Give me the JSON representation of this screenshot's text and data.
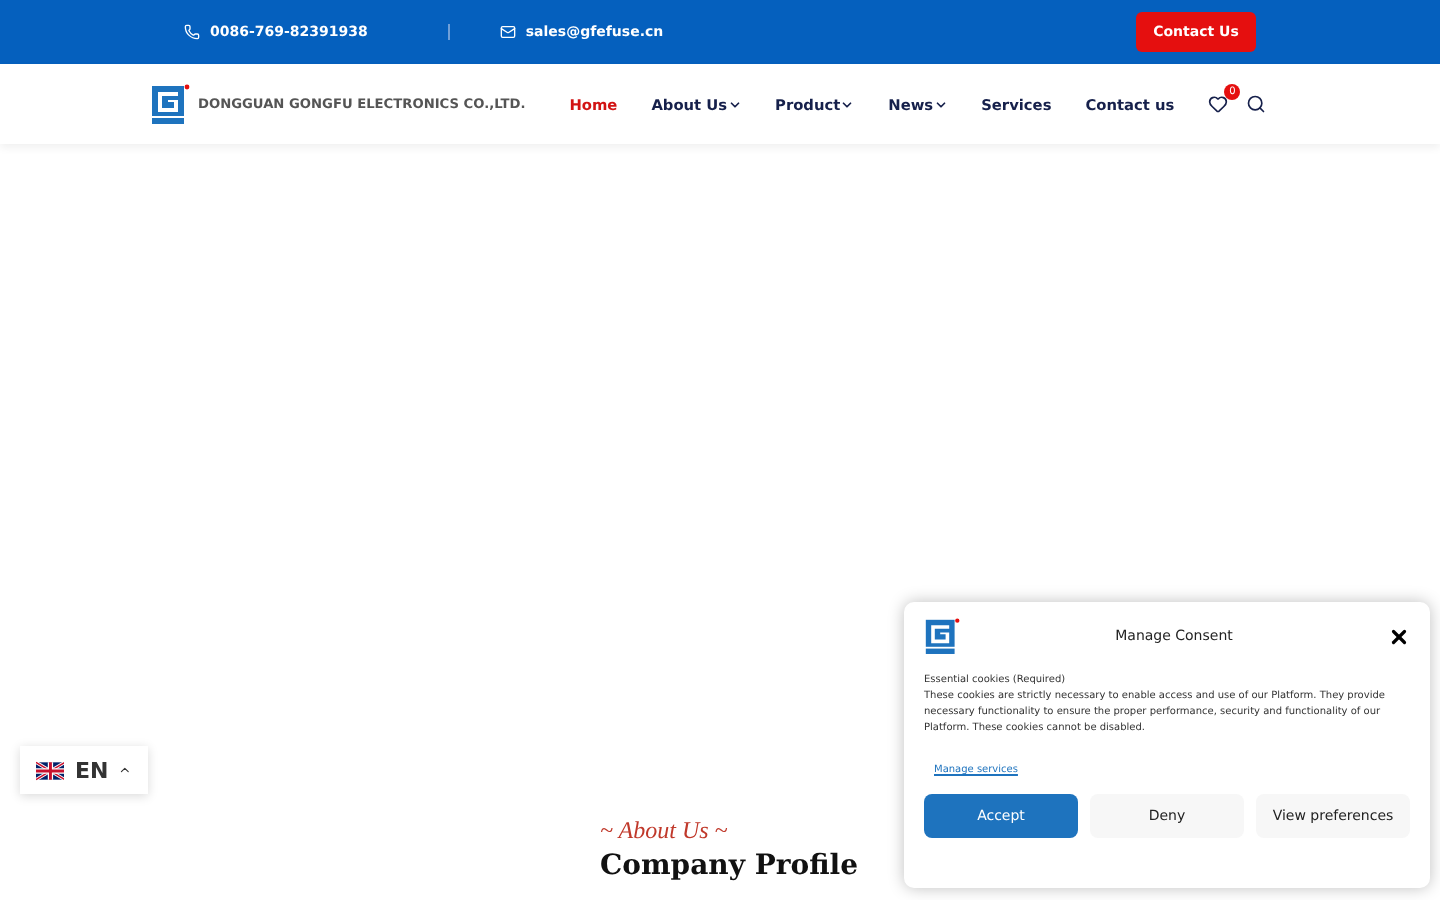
{
  "top_bar": {
    "phone": "0086-769-82391938",
    "email": "sales@gfefuse.cn",
    "contact_button": "Contact Us"
  },
  "header": {
    "company_name": "DONGGUAN GONGFU ELECTRONICS CO.,LTD.",
    "nav": [
      {
        "label": "Home",
        "selected": true,
        "dropdown": false
      },
      {
        "label": "About Us",
        "selected": false,
        "dropdown": true
      },
      {
        "label": "Product",
        "selected": false,
        "dropdown": true
      },
      {
        "label": "News",
        "selected": false,
        "dropdown": true
      },
      {
        "label": "Services",
        "selected": false,
        "dropdown": false
      },
      {
        "label": "Contact us",
        "selected": false,
        "dropdown": false
      }
    ],
    "wishlist_count": "0"
  },
  "section": {
    "eyebrow": "~ About Us ~",
    "heading": "Company Profile"
  },
  "language": {
    "code": "EN"
  },
  "consent": {
    "title": "Manage Consent",
    "subtitle": "Essential cookies (Required)",
    "text": "These cookies are strictly necessary to enable access and use of our Platform. They provide necessary functionality to ensure the proper performance, security and functionality of our Platform. These cookies cannot be disabled.",
    "link": "Manage services",
    "buttons": [
      {
        "label": "Accept",
        "kind": "primary"
      },
      {
        "label": "Deny",
        "kind": "secondary"
      },
      {
        "label": "View preferences",
        "kind": "secondary"
      }
    ]
  }
}
